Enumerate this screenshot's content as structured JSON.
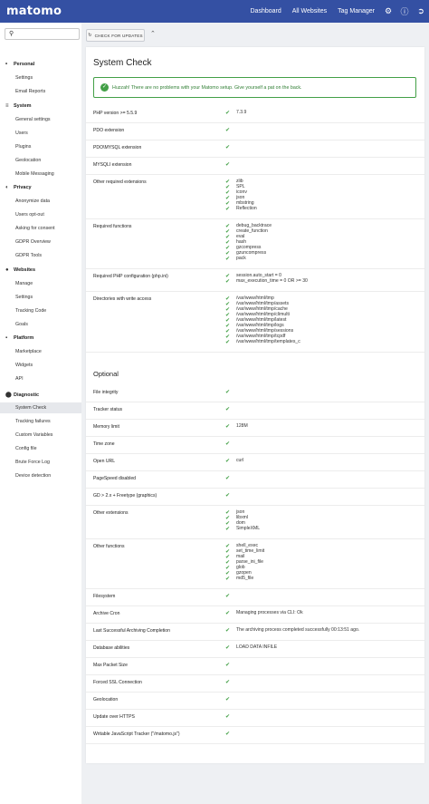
{
  "topbar": {
    "logo": "matomo",
    "nav": [
      "Dashboard",
      "All Websites",
      "Tag Manager"
    ],
    "icons": [
      "gear-icon",
      "help-icon",
      "logout-icon"
    ]
  },
  "sidebar": {
    "search_placeholder": "",
    "sections": [
      {
        "name": "Personal",
        "icon": "person-icon",
        "items": [
          "Settings",
          "Email Reports"
        ]
      },
      {
        "name": "System",
        "icon": "server-icon",
        "items": [
          "General settings",
          "Users",
          "Plugins",
          "Geolocation",
          "Mobile Messaging"
        ]
      },
      {
        "name": "Privacy",
        "icon": "privacy-icon",
        "items": [
          "Anonymize data",
          "Users opt-out",
          "Asking for consent",
          "GDPR Overview",
          "GDPR Tools"
        ]
      },
      {
        "name": "Websites",
        "icon": "globe-icon",
        "items": [
          "Manage",
          "Settings",
          "Tracking Code",
          "Goals"
        ]
      },
      {
        "name": "Platform",
        "icon": "platform-icon",
        "items": [
          "Marketplace",
          "Widgets",
          "API"
        ]
      },
      {
        "name": "Diagnostic",
        "icon": "diagnostic-icon",
        "items": [
          "System Check",
          "Tracking failures",
          "Custom Variables",
          "Config file",
          "Brute Force Log",
          "Device detection"
        ]
      }
    ],
    "active_item": "System Check"
  },
  "toolbar": {
    "check_updates": "CHECK FOR UPDATES"
  },
  "page": {
    "title": "System Check",
    "success_message": "Huzzah! There are no problems with your Matomo setup. Give yourself a pat on the back.",
    "optional_title": "Optional"
  },
  "required_rows": [
    {
      "label": "PHP version >= 5.5.9",
      "values": [
        "7.3.9"
      ]
    },
    {
      "label": "PDO extension",
      "values": []
    },
    {
      "label": "PDO\\MYSQL extension",
      "values": []
    },
    {
      "label": "MYSQLI extension",
      "values": []
    },
    {
      "label": "Other required extensions",
      "values": [
        "zlib",
        "SPL",
        "iconv",
        "json",
        "mbstring",
        "Reflection"
      ]
    },
    {
      "label": "Required functions",
      "values": [
        "debug_backtrace",
        "create_function",
        "eval",
        "hash",
        "gzcompress",
        "gzuncompress",
        "pack"
      ]
    },
    {
      "label": "Required PHP configuration (php.ini)",
      "values": [
        "session.auto_start = 0",
        "max_execution_time = 0 OR >= 30"
      ]
    },
    {
      "label": "Directories with write access",
      "values": [
        "/var/www/html/tmp",
        "/var/www/html/tmp/assets",
        "/var/www/html/tmp/cache",
        "/var/www/html/tmp/climulti",
        "/var/www/html/tmp/latest",
        "/var/www/html/tmp/logs",
        "/var/www/html/tmp/sessions",
        "/var/www/html/tmp/tcpdf",
        "/var/www/html/tmp/templates_c"
      ]
    }
  ],
  "optional_rows": [
    {
      "label": "File integrity",
      "values": []
    },
    {
      "label": "Tracker status",
      "values": []
    },
    {
      "label": "Memory limit",
      "values": [
        "128M"
      ]
    },
    {
      "label": "Time zone",
      "values": []
    },
    {
      "label": "Open URL",
      "values": [
        "curl"
      ]
    },
    {
      "label": "PageSpeed disabled",
      "values": []
    },
    {
      "label": "GD > 2.x + Freetype (graphics)",
      "values": []
    },
    {
      "label": "Other extensions",
      "values": [
        "json",
        "libxml",
        "dom",
        "SimpleXML"
      ]
    },
    {
      "label": "Other functions",
      "values": [
        "shell_exec",
        "set_time_limit",
        "mail",
        "parse_ini_file",
        "glob",
        "gzopen",
        "md5_file"
      ]
    },
    {
      "label": "Filesystem",
      "values": []
    },
    {
      "label": "Archive Cron",
      "values": [
        "Managing processes via CLI: Ok"
      ]
    },
    {
      "label": "Last Successful Archiving Completion",
      "values": [
        "The archiving process completed successfully 00:13:51 ago."
      ]
    },
    {
      "label": "Database abilities",
      "values": [
        "LOAD DATA INFILE"
      ]
    },
    {
      "label": "Max Packet Size",
      "values": []
    },
    {
      "label": "Forced SSL Connection",
      "values": []
    },
    {
      "label": "Geolocation",
      "values": []
    },
    {
      "label": "Update over HTTPS",
      "values": []
    },
    {
      "label": "Writable JavaScript Tracker (\"/matomo.js\")",
      "values": []
    }
  ],
  "colors": {
    "topbar": "#3450a3",
    "success": "#43a047"
  }
}
